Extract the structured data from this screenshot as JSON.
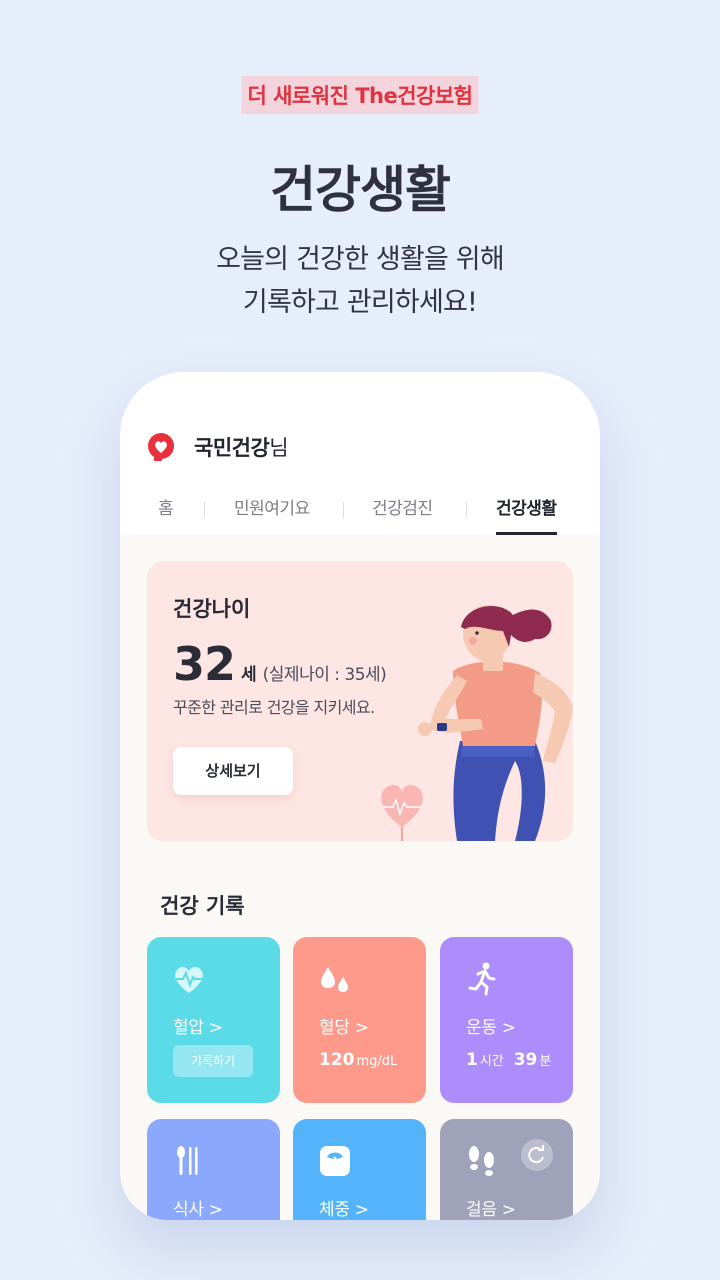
{
  "promo": {
    "tag": "더 새로워진 The건강보험",
    "headline": "건강생활",
    "subline_1": "오늘의 건강한 생활을 위해",
    "subline_2": "기록하고 관리하세요!"
  },
  "app": {
    "user_name": "국민건강",
    "user_suffix": "님",
    "tabs": [
      {
        "label": "홈",
        "active": false
      },
      {
        "label": "민원여기요",
        "active": false
      },
      {
        "label": "건강검진",
        "active": false
      },
      {
        "label": "건강생활",
        "active": true
      }
    ]
  },
  "health_age": {
    "title": "건강나이",
    "age": "32",
    "unit": "세",
    "real_age": "(실제나이 : 35세)",
    "description": "꾸준한 관리로 건강을 지키세요.",
    "detail_button": "상세보기"
  },
  "records": {
    "title": "건강 기록",
    "tiles": [
      {
        "label": "혈압 >",
        "button": "기록하기",
        "color": "#5bdbe8",
        "icon": "heart-pulse-icon"
      },
      {
        "label": "혈당 >",
        "value": "120",
        "unit": "mg/dL",
        "color": "#fd9a8c",
        "icon": "blood-drop-icon"
      },
      {
        "label": "운동 >",
        "value_h": "1",
        "unit_h": "시간",
        "value_m": "39",
        "unit_m": "분",
        "color": "#ad8cfb",
        "icon": "running-icon"
      },
      {
        "label": "식사 >",
        "color": "#8ca8fc",
        "icon": "fork-knife-icon"
      },
      {
        "label": "체중 >",
        "color": "#54b4fb",
        "icon": "scale-icon"
      },
      {
        "label": "걸음 >",
        "color": "#9fa2b8",
        "icon": "footsteps-icon"
      }
    ]
  }
}
